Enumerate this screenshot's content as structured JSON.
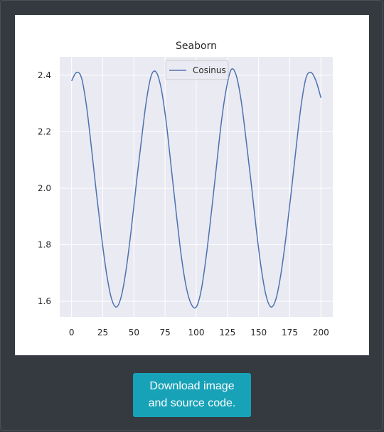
{
  "download_button": {
    "line1": "Download image",
    "line2": "and source code."
  },
  "colors": {
    "page_bg": "#343a40",
    "plot_bg": "#eaeaf2",
    "grid": "#ffffff",
    "series": "#4c72b0",
    "button_bg": "#17a2b8"
  },
  "chart_data": {
    "type": "line",
    "title": "Seaborn",
    "xlabel": "",
    "ylabel": "",
    "xlim": [
      -9.5,
      209.5
    ],
    "ylim": [
      1.545,
      2.465
    ],
    "x_ticks": [
      0,
      25,
      50,
      75,
      100,
      125,
      150,
      175,
      200
    ],
    "y_ticks": [
      1.6,
      1.8,
      2.0,
      2.2,
      2.4
    ],
    "x_tick_labels": [
      "0",
      "25",
      "50",
      "75",
      "100",
      "125",
      "150",
      "175",
      "200"
    ],
    "y_tick_labels": [
      "1.6",
      "1.8",
      "2.0",
      "2.2",
      "2.4"
    ],
    "grid": true,
    "legend": "upper center",
    "series": [
      {
        "name": "Cosinus",
        "x": [
          0,
          4,
          8,
          12,
          16,
          20,
          24,
          28,
          32,
          36,
          40,
          44,
          48,
          52,
          56,
          60,
          64,
          68,
          72,
          76,
          80,
          84,
          88,
          92,
          96,
          100,
          104,
          108,
          112,
          116,
          120,
          124,
          128,
          132,
          136,
          140,
          144,
          148,
          152,
          156,
          160,
          164,
          168,
          172,
          176,
          180,
          184,
          188,
          192,
          196,
          200
        ],
        "y": [
          2.38,
          2.41,
          2.39,
          2.29,
          2.14,
          1.98,
          1.83,
          1.7,
          1.61,
          1.58,
          1.62,
          1.72,
          1.86,
          2.02,
          2.17,
          2.31,
          2.4,
          2.41,
          2.35,
          2.23,
          2.07,
          1.91,
          1.76,
          1.65,
          1.59,
          1.58,
          1.64,
          1.76,
          1.91,
          2.07,
          2.23,
          2.35,
          2.42,
          2.4,
          2.31,
          2.17,
          2.02,
          1.86,
          1.72,
          1.62,
          1.58,
          1.61,
          1.7,
          1.83,
          1.98,
          2.14,
          2.29,
          2.39,
          2.41,
          2.38,
          2.32
        ]
      }
    ]
  }
}
